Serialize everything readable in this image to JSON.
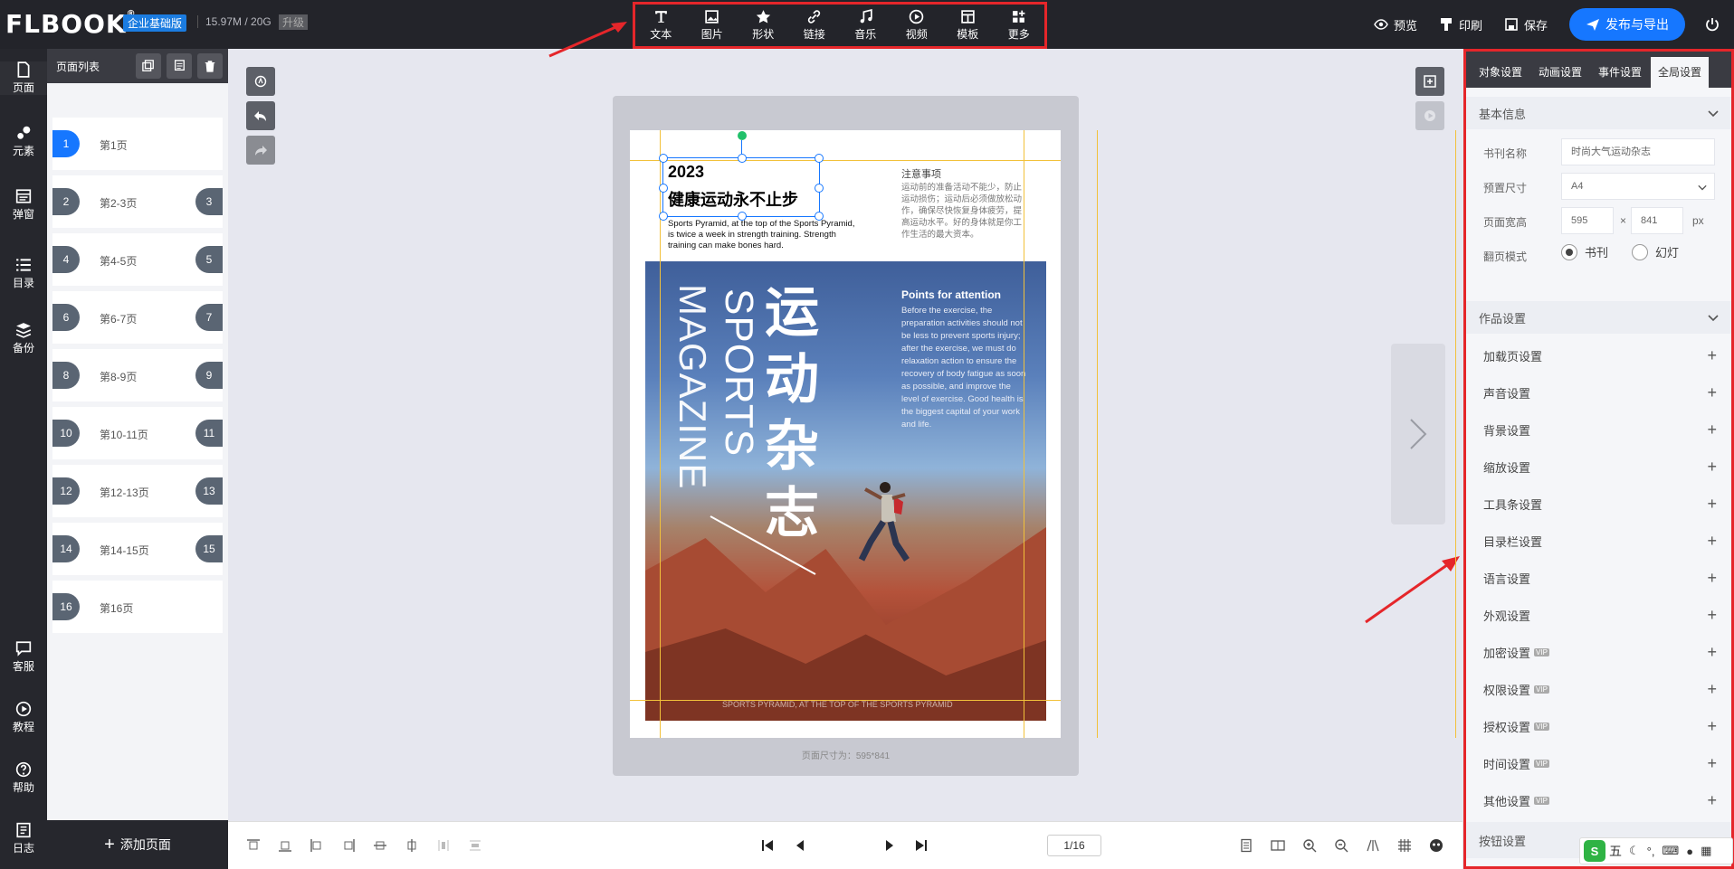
{
  "header": {
    "logo": "FLBOOK",
    "logo_mark": "®",
    "edition": "企业基础版",
    "storage": "15.97M / 20G",
    "upgrade": "升级",
    "tools": [
      {
        "label": "文本",
        "icon": "text-icon"
      },
      {
        "label": "图片",
        "icon": "image-icon"
      },
      {
        "label": "形状",
        "icon": "star-icon"
      },
      {
        "label": "链接",
        "icon": "link-icon"
      },
      {
        "label": "音乐",
        "icon": "music-icon"
      },
      {
        "label": "视频",
        "icon": "video-icon"
      },
      {
        "label": "模板",
        "icon": "template-icon"
      },
      {
        "label": "更多",
        "icon": "more-icon"
      }
    ],
    "preview": "预览",
    "print": "印刷",
    "save": "保存",
    "publish": "发布与导出"
  },
  "sidenav": {
    "items": [
      {
        "label": "页面",
        "icon": "page-icon"
      },
      {
        "label": "元素",
        "icon": "elements-icon"
      },
      {
        "label": "弹窗",
        "icon": "popup-icon"
      },
      {
        "label": "目录",
        "icon": "list-icon"
      },
      {
        "label": "备份",
        "icon": "backup-icon"
      }
    ],
    "bottom_items": [
      {
        "label": "客服",
        "icon": "chat-icon"
      },
      {
        "label": "教程",
        "icon": "play-icon"
      },
      {
        "label": "帮助",
        "icon": "help-icon"
      },
      {
        "label": "日志",
        "icon": "log-icon"
      }
    ]
  },
  "page_list": {
    "title": "页面列表",
    "add_page": "添加页面",
    "pages": [
      {
        "left": "1",
        "label": "第1页",
        "right": ""
      },
      {
        "left": "2",
        "label": "第2-3页",
        "right": "3"
      },
      {
        "left": "4",
        "label": "第4-5页",
        "right": "5"
      },
      {
        "left": "6",
        "label": "第6-7页",
        "right": "7"
      },
      {
        "left": "8",
        "label": "第8-9页",
        "right": "9"
      },
      {
        "left": "10",
        "label": "第10-11页",
        "right": "11"
      },
      {
        "left": "12",
        "label": "第12-13页",
        "right": "13"
      },
      {
        "left": "14",
        "label": "第14-15页",
        "right": "15"
      },
      {
        "left": "16",
        "label": "第16页",
        "right": ""
      }
    ]
  },
  "canvas": {
    "year": "2023",
    "headline": "健康运动永不止步",
    "intro": "Sports Pyramid, at the top of the Sports Pyramid, is twice a week in strength training. Strength training can make bones hard.",
    "notice_title": "注意事项",
    "notice_body": "运动前的准备活动不能少，防止运动损伤；运动后必须做放松动作，确保尽快恢复身体疲劳，提高运动水平。好的身体就是你工作生活的最大资本。",
    "cover_cn": "运动杂志",
    "cover_sports": "SPORTS",
    "cover_magazine": "MAGAZINE",
    "pfa_title": "Points for attention",
    "pfa_body": "Before the exercise, the preparation activities should not be less to prevent sports injury; after the exercise, we must do relaxation action to ensure the recovery of body fatigue as soon as possible, and improve the level of exercise. Good health is the biggest capital of your work and life.",
    "footer_text": "SPORTS PYRAMID, AT THE TOP OF THE SPORTS PYRAMID",
    "size_caption": "页面尺寸为：595*841"
  },
  "bottom": {
    "pager": "1/16"
  },
  "right_panel": {
    "tabs": [
      "对象设置",
      "动画设置",
      "事件设置",
      "全局设置"
    ],
    "basic_title": "基本信息",
    "book_name_label": "书刊名称",
    "book_name_value": "时尚大气运动杂志",
    "preset_label": "预置尺寸",
    "preset_value": "A4",
    "size_label": "页面宽高",
    "width": "595",
    "times": "×",
    "height": "841",
    "unit": "px",
    "flip_label": "翻页模式",
    "flip_book": "书刊",
    "flip_slide": "幻灯",
    "work_title": "作品设置",
    "settings": [
      {
        "label": "加载页设置",
        "vip": ""
      },
      {
        "label": "声音设置",
        "vip": ""
      },
      {
        "label": "背景设置",
        "vip": ""
      },
      {
        "label": "缩放设置",
        "vip": ""
      },
      {
        "label": "工具条设置",
        "vip": ""
      },
      {
        "label": "目录栏设置",
        "vip": ""
      },
      {
        "label": "语言设置",
        "vip": ""
      },
      {
        "label": "外观设置",
        "vip": ""
      },
      {
        "label": "加密设置",
        "vip": "VIP"
      },
      {
        "label": "权限设置",
        "vip": "VIP"
      },
      {
        "label": "授权设置",
        "vip": "VIP"
      },
      {
        "label": "时间设置",
        "vip": "VIP"
      },
      {
        "label": "其他设置",
        "vip": "VIP"
      }
    ],
    "button_settings": "按钮设置"
  },
  "ime": {
    "label": "五"
  },
  "colors": {
    "accent": "#1677ff",
    "highlight": "#e5262a",
    "dark": "#23242a"
  }
}
